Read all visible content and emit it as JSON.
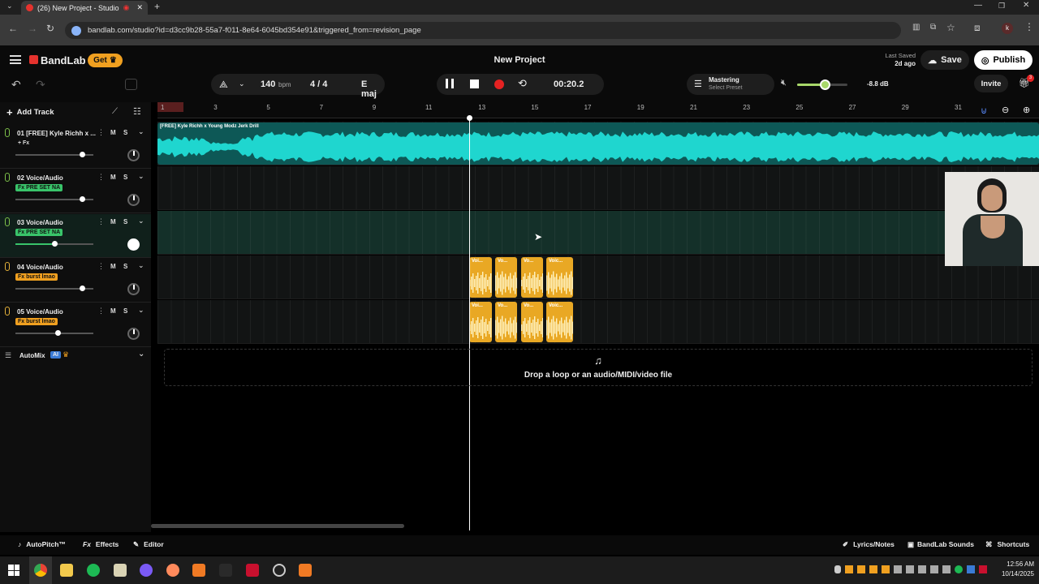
{
  "browser": {
    "tab_title": "(26) New Project - Studio",
    "url": "bandlab.com/studio?id=d3cc9b28-55a7-f011-8e64-6045bd354e91&triggered_from=revision_page"
  },
  "header": {
    "brand": "BandLab",
    "get_label": "Get",
    "project_title": "New Project",
    "last_saved_label": "Last Saved",
    "last_saved_value": "2d ago",
    "save_label": "Save",
    "publish_label": "Publish",
    "invite_label": "Invite",
    "gift_badge": "3"
  },
  "transport": {
    "bpm_value": "140",
    "bpm_unit": "bpm",
    "time_signature": "4 / 4",
    "key": "E maj",
    "time": "00:20.2",
    "mastering_label": "Mastering",
    "mastering_preset": "Select Preset",
    "volume_db": "-8.8 dB",
    "volume_level": 0.55
  },
  "track_panel": {
    "add_track_label": "Add Track",
    "tracks": [
      {
        "name": "01  [FREE] Kyle Richh x ...",
        "fx": "+ Fx",
        "fx_style": "plain",
        "mute": "M",
        "solo": "S",
        "volume": 0.88
      },
      {
        "name": "02  Voice/Audio",
        "fx": "Fx PRE SET NA",
        "fx_style": "green",
        "mute": "M",
        "solo": "S",
        "volume": 0.88
      },
      {
        "name": "03  Voice/Audio",
        "fx": "Fx PRE SET NA",
        "fx_style": "green",
        "mute": "M",
        "solo": "S",
        "volume": 0.5
      },
      {
        "name": "04  Voice/Audio",
        "fx": "Fx burst lmao",
        "fx_style": "orange",
        "mute": "M",
        "solo": "S",
        "volume": 0.88
      },
      {
        "name": "05  Voice/Audio",
        "fx": "Fx burst lmao",
        "fx_style": "orange",
        "mute": "M",
        "solo": "S",
        "volume": 0.54
      }
    ],
    "automix_label": "AutoMix",
    "ai_badge": "AI"
  },
  "ruler": {
    "ticks": [
      "1",
      "3",
      "5",
      "7",
      "9",
      "11",
      "13",
      "15",
      "17",
      "19",
      "21",
      "23",
      "25",
      "27",
      "29",
      "31"
    ]
  },
  "clips": {
    "main_clip_label": "[FREE] Kyle Richh x Young Modz Jerk Drill",
    "track4_clips": [
      "Voi...",
      "Vo...",
      "Vo...",
      "Voic..."
    ],
    "track5_clips": [
      "Voi...",
      "Vo...",
      "Vo...",
      "Voic..."
    ]
  },
  "drop_zone": {
    "text": "Drop a loop or an audio/MIDI/video file"
  },
  "bottom_bar": {
    "autopitch": "AutoPitch™",
    "effects": "Effects",
    "editor": "Editor",
    "lyrics": "Lyrics/Notes",
    "sounds": "BandLab Sounds",
    "shortcuts": "Shortcuts"
  },
  "taskbar": {
    "time": "12:56 AM",
    "date": "10/14/2025"
  },
  "colors": {
    "accent_cyan": "#1fd6cf",
    "clip_orange": "#e9a824",
    "fx_green": "#39c46a",
    "fx_orange": "#f0a020",
    "record_red": "#e52222"
  }
}
